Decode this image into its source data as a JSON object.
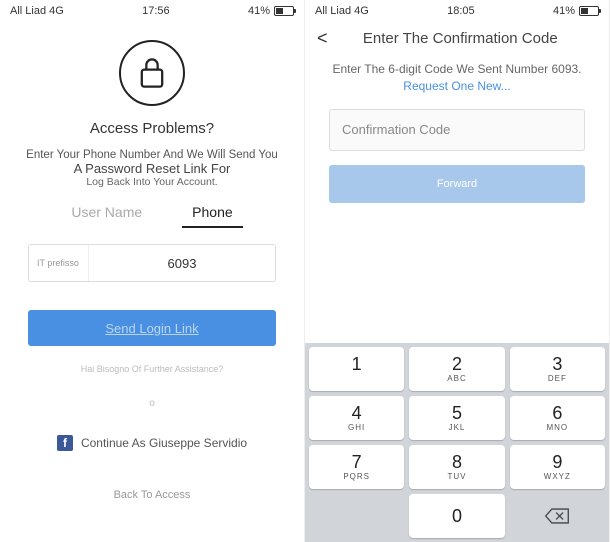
{
  "status": {
    "carrier": "All Liad 4G",
    "time1": "17:56",
    "time2": "18:05",
    "battery": "41%"
  },
  "screen1": {
    "title": "Access Problems?",
    "line1": "Enter Your Phone Number And We Will Send You",
    "line2": "A Password Reset Link For",
    "line3": "Log Back Into Your Account.",
    "tabs": {
      "username": "User Name",
      "phone": "Phone"
    },
    "prefix": "IT prefisso",
    "phone": "6093",
    "sendBtn": "Send Login Link",
    "assist": "Hai Bisogno Of Further Assistance?",
    "dividerO": "o",
    "fb": "Continue As Giuseppe Servidio",
    "back": "Back To Access"
  },
  "screen2": {
    "title": "Enter The Confirmation Code",
    "sub1": "Enter The 6-digit Code We Sent Number 6093.",
    "requestLink": "Request One New...",
    "placeholder": "Confirmation Code",
    "fwd": "Forward"
  },
  "keypad": [
    {
      "n": "1",
      "l": ""
    },
    {
      "n": "2",
      "l": "ABC"
    },
    {
      "n": "3",
      "l": "DEF"
    },
    {
      "n": "4",
      "l": "GHI"
    },
    {
      "n": "5",
      "l": "JKL"
    },
    {
      "n": "6",
      "l": "MNO"
    },
    {
      "n": "7",
      "l": "PQRS"
    },
    {
      "n": "8",
      "l": "TUV"
    },
    {
      "n": "9",
      "l": "WXYZ"
    },
    {
      "n": "",
      "l": ""
    },
    {
      "n": "0",
      "l": ""
    },
    {
      "n": "del",
      "l": ""
    }
  ]
}
